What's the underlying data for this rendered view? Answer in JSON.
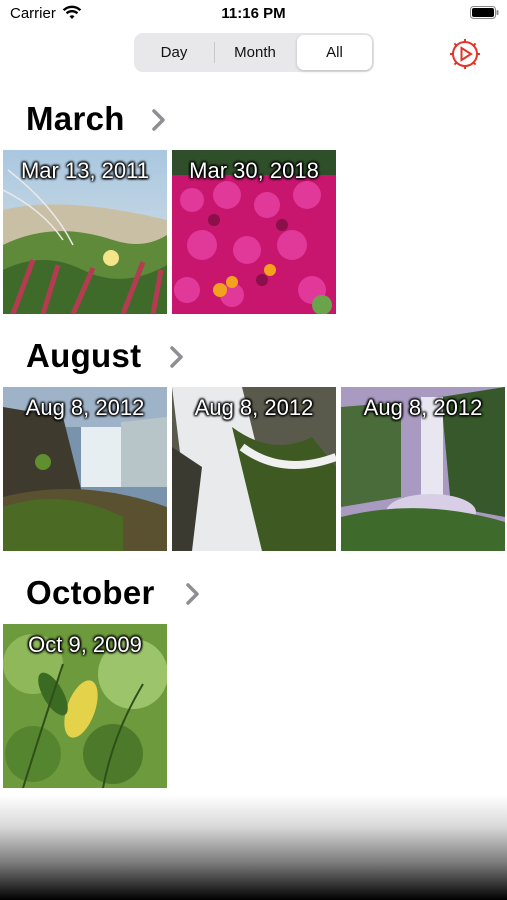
{
  "status_bar": {
    "carrier": "Carrier",
    "time": "11:16 PM"
  },
  "segmented": {
    "day": "Day",
    "month": "Month",
    "all": "All",
    "selected": "All"
  },
  "colors": {
    "accent": "#e0362c"
  },
  "sections": [
    {
      "title": "March",
      "photos": [
        {
          "date": "Mar 13, 2011"
        },
        {
          "date": "Mar 30, 2018"
        }
      ]
    },
    {
      "title": "August",
      "photos": [
        {
          "date": "Aug 8, 2012"
        },
        {
          "date": "Aug 8, 2012"
        },
        {
          "date": "Aug 8, 2012"
        }
      ]
    },
    {
      "title": "October",
      "photos": [
        {
          "date": "Oct 9, 2009"
        }
      ]
    }
  ]
}
